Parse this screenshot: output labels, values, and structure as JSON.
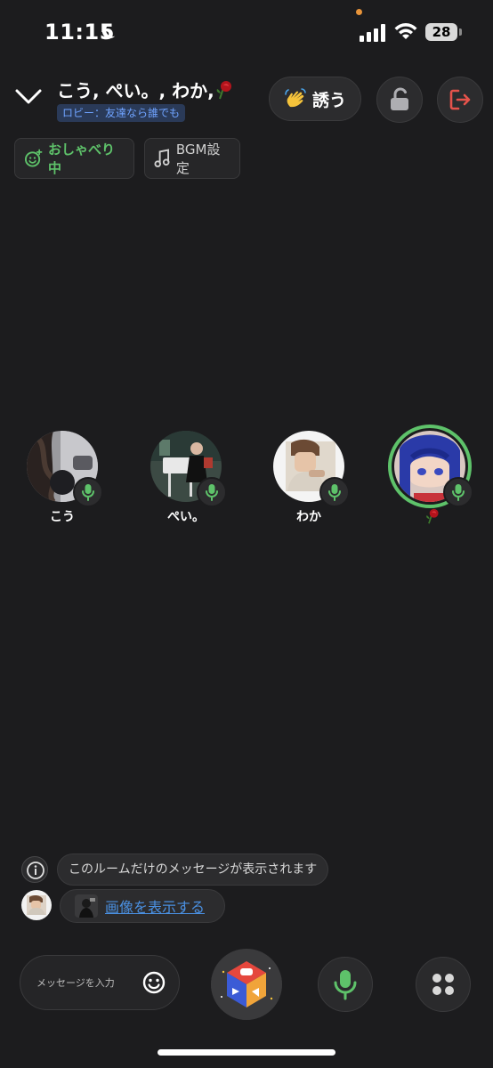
{
  "status_bar": {
    "time": "11:15",
    "battery": "28",
    "moon_icon": "moon-icon",
    "signal_icon": "signal-icon",
    "wifi_icon": "wifi-icon"
  },
  "header": {
    "room_title": "こう, ぺい。, わか,",
    "rose_icon": "rose-icon",
    "lobby_badge": "ロビー：友達なら誰でも",
    "invite_label": "誘う",
    "invite_icon": "waving-hand-icon",
    "lock_icon": "unlock-icon",
    "exit_icon": "exit-icon",
    "collapse_icon": "chevron-down-icon"
  },
  "chips": {
    "chatting_label": "おしゃべり中",
    "bgm_label": "BGM設定"
  },
  "participants": [
    {
      "name": "こう",
      "speaking": false,
      "mic": "on"
    },
    {
      "name": "ぺい。",
      "speaking": false,
      "mic": "on"
    },
    {
      "name": "わか",
      "speaking": false,
      "mic": "on"
    },
    {
      "name": "",
      "speaking": true,
      "mic": "on"
    }
  ],
  "messages": {
    "info_text": "このルームだけのメッセージが表示されます",
    "image_link": "画像を表示する"
  },
  "bottom_bar": {
    "input_placeholder": "メッセージを入力"
  },
  "colors": {
    "background": "#1c1c1e",
    "accent_green": "#5ec26a",
    "link_blue": "#4a90e2",
    "exit_red": "#e5534b"
  }
}
